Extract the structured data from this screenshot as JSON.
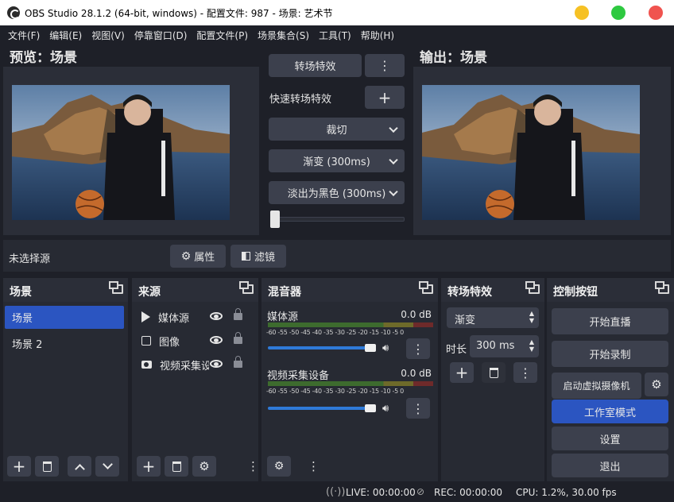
{
  "window": {
    "title": "OBS Studio 28.1.2 (64-bit, windows) - 配置文件: 987 - 场景: 艺术节"
  },
  "menu": [
    "文件(F)",
    "编辑(E)",
    "视图(V)",
    "停靠窗口(D)",
    "配置文件(P)",
    "场景集合(S)",
    "工具(T)",
    "帮助(H)"
  ],
  "preview": {
    "label": "预览：场景"
  },
  "program": {
    "label": "输出：场景"
  },
  "transition_center": {
    "transition_button": "转场特效",
    "quick_label": "快速转场特效",
    "option1": "裁切",
    "option2": "渐变 (300ms)",
    "option3": "淡出为黑色 (300ms)"
  },
  "source_toolbar": {
    "no_source": "未选择源",
    "properties": "属性",
    "filters": "滤镜"
  },
  "scenes": {
    "title": "场景",
    "items": [
      {
        "name": "场景",
        "selected": true
      },
      {
        "name": "场景 2",
        "selected": false
      }
    ]
  },
  "sources": {
    "title": "来源",
    "items": [
      {
        "name": "媒体源",
        "icon": "play-icon"
      },
      {
        "name": "图像",
        "icon": "image-icon"
      },
      {
        "name": "视频采集设备",
        "icon": "camera-icon"
      }
    ]
  },
  "mixer": {
    "title": "混音器",
    "channels": [
      {
        "name": "媒体源",
        "db": "0.0 dB",
        "volume": 1.0
      },
      {
        "name": "视频采集设备",
        "db": "0.0 dB",
        "volume": 1.0
      }
    ],
    "scale": "-60 -55 -50 -45 -40 -35 -30 -25 -20 -15 -10 -5  0"
  },
  "transitions": {
    "title": "转场特效",
    "selected": "渐变",
    "duration_label": "时长",
    "duration_value": "300 ms"
  },
  "controls": {
    "title": "控制按钮",
    "start_stream": "开始直播",
    "start_record": "开始录制",
    "virtual_cam": "启动虚拟摄像机",
    "studio_mode": "工作室模式",
    "settings": "设置",
    "exit": "退出"
  },
  "status": {
    "live": "LIVE: 00:00:00",
    "rec": "REC: 00:00:00",
    "cpu": "CPU: 1.2%, 30.00 fps"
  },
  "colors": {
    "accent": "#2b55c1",
    "bg": "#1e2028",
    "panel": "#272a33",
    "button": "#3c404d"
  }
}
